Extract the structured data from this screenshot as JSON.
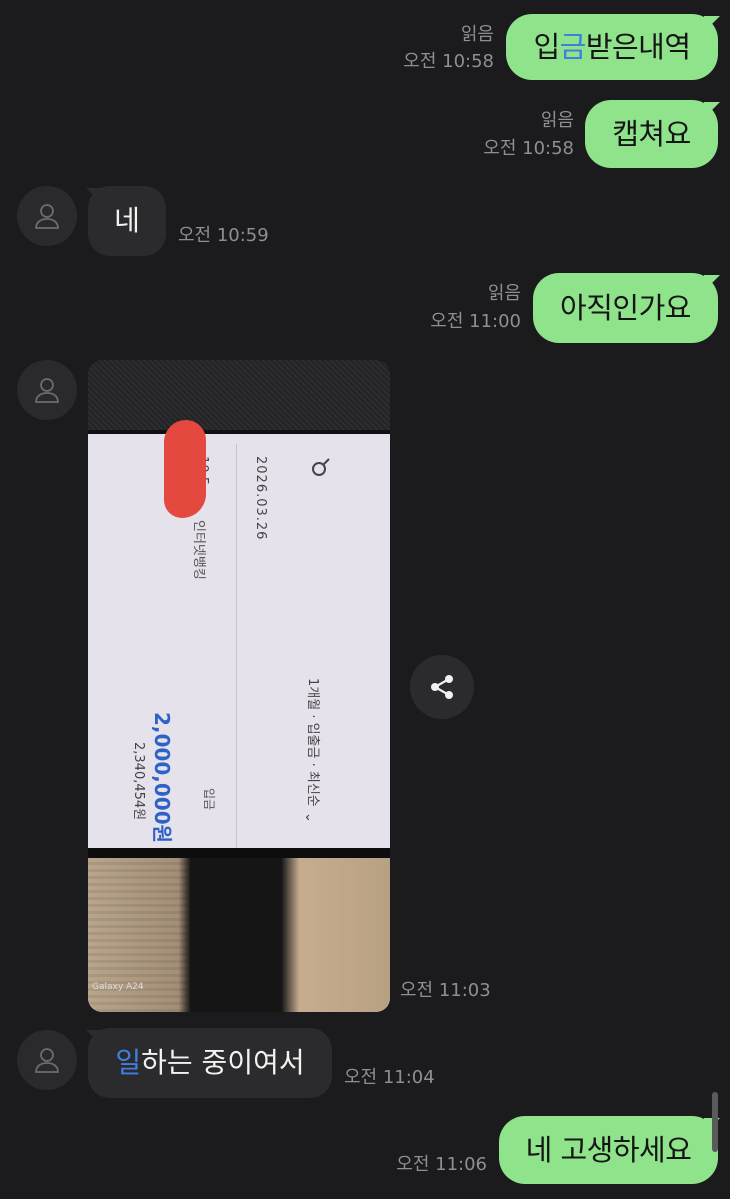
{
  "messages": [
    {
      "from": "me",
      "text_pre": "입",
      "text_hl": "금",
      "text_post": "받은내역",
      "read": "읽음",
      "time": "오전 10:58"
    },
    {
      "from": "me",
      "text": "캡쳐요",
      "read": "읽음",
      "time": "오전 10:58"
    },
    {
      "from": "them",
      "text": "네",
      "time": "오전 10:59"
    },
    {
      "from": "me",
      "text": "아직인가요",
      "read": "읽음",
      "time": "오전 11:00"
    },
    {
      "from": "them",
      "type": "photo",
      "time": "오전 11:03"
    },
    {
      "from": "them",
      "text_hl": "일",
      "text_post": "하는 중이여서",
      "time": "오전 11:04"
    },
    {
      "from": "me",
      "text": "네 고생하세요",
      "time": "오전 11:06"
    }
  ],
  "photo": {
    "date": "2026.03.26",
    "time_partial": "10:5",
    "bank": "인터넷뱅킹",
    "filter": "1개월 · 입출금 · 최신순",
    "type": "입금",
    "amount": "2,000,000원",
    "balance": "2,340,454원",
    "watermark": "Galaxy A24"
  },
  "icons": {
    "avatar": "person-icon",
    "share": "share-icon",
    "search": "search-icon"
  },
  "colors": {
    "background": "#1b1b1d",
    "my_bubble": "#8fe38a",
    "their_bubble": "#2b2b2d",
    "highlight": "#3f7fe0",
    "amount": "#2e62c9"
  }
}
